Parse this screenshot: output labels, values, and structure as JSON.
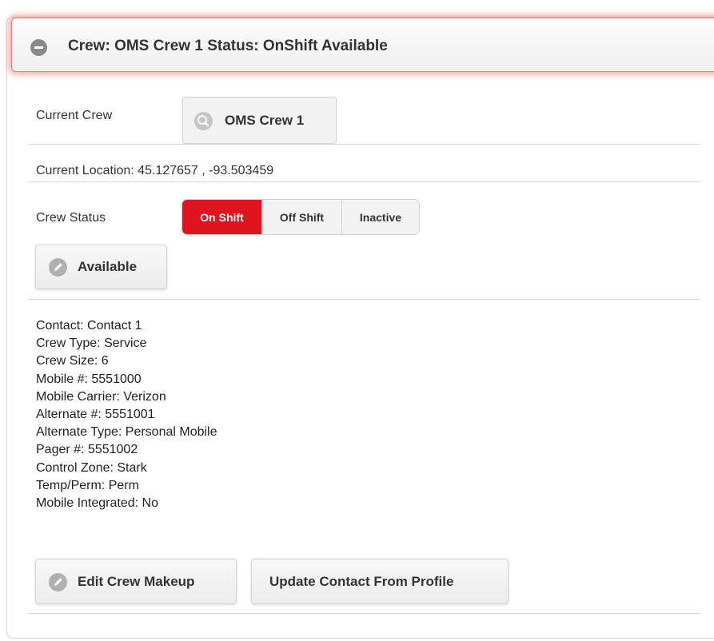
{
  "header": {
    "title": "Crew: OMS Crew 1 Status: OnShift Available",
    "icon": "collapse-minus-icon"
  },
  "current_crew": {
    "label": "Current Crew",
    "value": "OMS Crew 1",
    "icon": "search-icon"
  },
  "location": {
    "text": "Current Location: 45.127657 , -93.503459"
  },
  "crew_status": {
    "label": "Crew Status",
    "options": [
      "On Shift",
      "Off Shift",
      "Inactive"
    ],
    "selected": "On Shift",
    "accent_color": "#e0141e",
    "availability_button": "Available",
    "availability_icon": "edit-pencil-icon"
  },
  "details": [
    "Contact: Contact 1",
    "Crew Type: Service",
    "Crew Size: 6",
    "Mobile #: 5551000",
    "Mobile Carrier: Verizon",
    "Alternate #: 5551001",
    "Alternate Type: Personal Mobile",
    "Pager #: 5551002",
    "Control Zone: Stark",
    "Temp/Perm: Perm",
    "Mobile Integrated: No"
  ],
  "actions": {
    "edit_crew_makeup": "Edit Crew Makeup",
    "edit_icon": "edit-pencil-icon",
    "update_contact": "Update Contact From Profile"
  }
}
